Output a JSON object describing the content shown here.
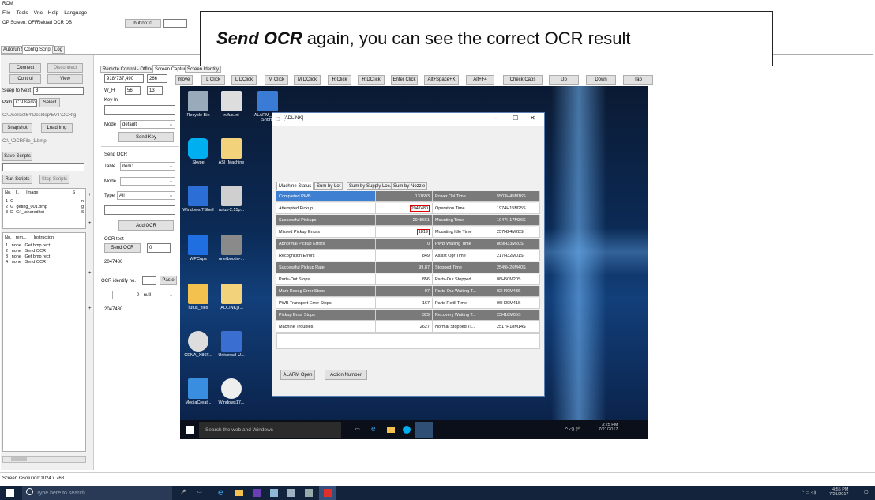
{
  "app": {
    "title": "RCM"
  },
  "menu": [
    "File",
    "Tools",
    "Vnc",
    "Help",
    "Language"
  ],
  "toolbar": {
    "op_screen": "OP Screen: OFF",
    "reload": "Reload OCR DB",
    "button10": "button10"
  },
  "main_tabs": [
    "Autorun Script",
    "Config Script",
    "Log"
  ],
  "left": {
    "connect": "Connect",
    "disconnect": "Disconnect",
    "control": "Control",
    "view": "View",
    "sleep_label": "Sleep to Next",
    "sleep_value": "3",
    "path_label": "Path",
    "path_value": "C:\\Users\\st",
    "select": "Select",
    "path_full": "C:\\Users\\st64\\Desktop\\EVT\\OCR\\g",
    "snapshot": "Snapshot",
    "load_img": "Load Img",
    "ocr_file": "C:\\_\\OCRFile_1.bmp",
    "save_scripts": "Save Scripts",
    "run_scripts": "Run Scripts",
    "stop_scripts": "Stop Scripts",
    "img_headers": [
      "No.",
      "I..",
      "Image",
      "S"
    ],
    "img_rows": [
      [
        "1",
        "C",
        "",
        "n"
      ],
      [
        "2",
        "G",
        "geting_001.bmp",
        "g"
      ],
      [
        "3",
        "D",
        "C:\\_\\shared.txt",
        "S"
      ]
    ],
    "instr_headers": [
      "No.",
      "rem...",
      "Instruction"
    ],
    "instr_rows": [
      [
        "1",
        "none",
        "Get bmp rect"
      ],
      [
        "2",
        "none",
        "Send OCR"
      ],
      [
        "3",
        "none",
        "Get bmp rect"
      ],
      [
        "4",
        "none",
        "Send OCR"
      ]
    ]
  },
  "mid": {
    "tabs": [
      "Remote Control - Offline",
      "Screen Capture",
      "Screen Identify"
    ],
    "coords": "918*737,490",
    "coord2": "266",
    "wh_label": "W_H",
    "w": "56",
    "h": "13",
    "key_in": "Key In",
    "mode_label": "Mode",
    "mode_value": "default",
    "send_key": "Send Key",
    "send_ocr_label": "Send OCR",
    "table_label": "Table",
    "table_value": "item1",
    "mode2_label": "Mode",
    "type_label": "Type",
    "type_value": "All",
    "add_ocr": "Add OCR",
    "ocr_test": "OCR test",
    "send_ocr_btn": "Send OCR",
    "send_ocr_val": "0",
    "ocr_result": "2047480",
    "ocr_identify": "OCR identify no.",
    "paste": "Paste",
    "null_sel": "0 - null",
    "result2": "2047480"
  },
  "actions": [
    "move",
    "L Click",
    "L DClick",
    "M Click",
    "M DClick",
    "R Click",
    "R DClick",
    "Enter Click",
    "Alt+Space+X",
    "Alt+F4",
    "Check Caps",
    "Up",
    "Down",
    "Tab"
  ],
  "callout": {
    "bold": "Send OCR",
    "rest": "again, you can see the correct OCR result"
  },
  "desktop_icons": [
    {
      "label": "Recycle Bin",
      "color": "#9ab"
    },
    {
      "label": "rufus.ini",
      "color": "#ddd"
    },
    {
      "label": "ALARM_M... - Shortc",
      "color": "#3a7bd5"
    },
    {
      "label": "Skype",
      "color": "#00aff0"
    },
    {
      "label": "ASI_Machine",
      "color": "#f2d27a"
    },
    {
      "label": "Windows TShell",
      "color": "#2b6fd6"
    },
    {
      "label": "rufus-2.15p...",
      "color": "#cfcfcf"
    },
    {
      "label": "WPCups",
      "color": "#1f6fe0"
    },
    {
      "label": "unetbootin-...",
      "color": "#8a8a8a"
    },
    {
      "label": "rufus_files",
      "color": "#f2c14e"
    },
    {
      "label": "[ADLINK]T...",
      "color": "#f2d27a"
    },
    {
      "label": "CENA_X86F...",
      "color": "#dddddd"
    },
    {
      "label": "Universal-U...",
      "color": "#3a6ed0"
    },
    {
      "label": "MediaCreat...",
      "color": "#3a8ee0"
    },
    {
      "label": "Windows17...",
      "color": "#eeeeee"
    }
  ],
  "adlink": {
    "title": "[ADLINK]",
    "tabs": [
      "Machine Status",
      "Sum by Lot",
      "Sum by Supply Loc.",
      "Sum by Nozzle"
    ],
    "rows": [
      [
        "Completed PWB",
        "137693",
        "Power ON Time",
        "5503H45M16S"
      ],
      [
        "Attempted Pickup",
        "2047480",
        "Operation Time",
        "1974H15M25S"
      ],
      [
        "Successful Pickups",
        "2045661",
        "Mounting Time",
        "1047H17M36S"
      ],
      [
        "Missed Pickup Errors",
        "1819",
        "Mounting Idle Time",
        "257H24M28S"
      ],
      [
        "Abnormal Pickup Errors",
        "0",
        "PWB Waiting Time",
        "869H33M20S"
      ],
      [
        "Recognition Errors",
        "849",
        "Assist Opr Time",
        "217H32M01S"
      ],
      [
        "Successful Pickup Rate",
        "99.87",
        "Stopped Time",
        "2549H26M40S"
      ],
      [
        "Parts-Out Stops",
        "856",
        "Parts-Out Stopped ...",
        "08H50M20S"
      ],
      [
        "Mark Recog Error Stops",
        "97",
        "Parts-Out Waiting T...",
        "02H40M43S"
      ],
      [
        "PWB Transport Error Stops",
        "167",
        "Parts Refill Time",
        "06H09M41S"
      ],
      [
        "Pickup Error Stops",
        "329",
        "Recovery Waiting T...",
        "23H18M05S"
      ],
      [
        "Machine Troubles",
        "2627",
        "Normal Stopped Ti...",
        "2517H18M14S"
      ]
    ],
    "alarm_open": "ALARM Open",
    "action_number": "Action Number"
  },
  "remote_taskbar": {
    "search": "Search the web and Windows",
    "time": "3:25 PM",
    "date": "7/21/2017"
  },
  "status": {
    "resolution": "Screen resolution:1024 x 768"
  },
  "host_taskbar": {
    "search": "Type here to search",
    "time": "4:55 PM",
    "date": "7/21/2017"
  }
}
